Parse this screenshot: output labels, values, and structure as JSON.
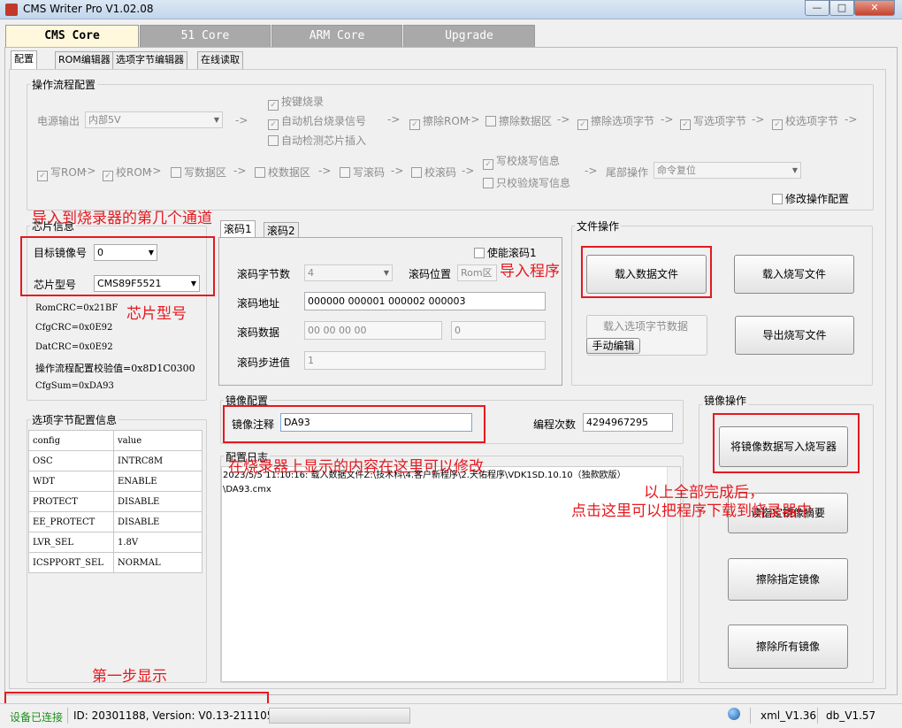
{
  "window": {
    "title": "CMS Writer Pro V1.02.08",
    "min": "—",
    "max": "□",
    "close": "✕"
  },
  "main_tabs": [
    "CMS Core",
    "51 Core",
    "ARM Core",
    "Upgrade"
  ],
  "sub_tabs": [
    "配置",
    "ROM编辑器",
    "选项字节编辑器",
    "在线读取"
  ],
  "flow": {
    "title": "操作流程配置",
    "power_label": "电源输出",
    "power_value": "内部5V",
    "steps1": [
      "按键烧录",
      "自动机台烧录信号",
      "自动检测芯片插入"
    ],
    "steps2": [
      "擦除ROM",
      "擦除数据区",
      "擦除选项字节",
      "写选项字节",
      "校选项字节"
    ],
    "steps3": [
      "写ROM",
      "校ROM",
      "写数据区",
      "校数据区",
      "写滚码",
      "校滚码"
    ],
    "steps4": [
      "写校烧写信息",
      "只校验烧写信息"
    ],
    "tail_label": "尾部操作",
    "tail_value": "命令复位",
    "modify": "修改操作配置",
    "arrow": "->"
  },
  "chip": {
    "title": "芯片信息",
    "mirror_label": "目标镜像号",
    "mirror_value": "0",
    "model_label": "芯片型号",
    "model_value": "CMS89F5521",
    "lines": [
      "RomCRC=0x21BF",
      "CfgCRC=0x0E92",
      "DatCRC=0x0E92",
      "操作流程配置校验值=0x8D1C0300",
      "CfgSum=0xDA93"
    ]
  },
  "option": {
    "title": "选项字节配置信息",
    "headers": [
      "config",
      "value"
    ],
    "rows": [
      [
        "OSC",
        "INTRC8M"
      ],
      [
        "WDT",
        "ENABLE"
      ],
      [
        "PROTECT",
        "DISABLE"
      ],
      [
        "EE_PROTECT",
        "DISABLE"
      ],
      [
        "LVR_SEL",
        "1.8V"
      ],
      [
        "ICSPPORT_SEL",
        "NORMAL"
      ]
    ]
  },
  "rolling": {
    "tabs": [
      "滚码1",
      "滚码2"
    ],
    "enable": "使能滚码1",
    "bytes_label": "滚码字节数",
    "bytes_value": "4",
    "pos_label": "滚码位置",
    "pos_value": "Rom区",
    "addr_label": "滚码地址",
    "addr_value": "000000 000001 000002 000003",
    "data_label": "滚码数据",
    "data_value": "00 00 00 00",
    "data_value2": "0",
    "step_label": "滚码步进值",
    "step_value": "1"
  },
  "file_ops": {
    "title": "文件操作",
    "load_data": "载入数据文件",
    "load_burn": "载入烧写文件",
    "load_option": "载入选项字节数据",
    "manual": "手动编辑",
    "export": "导出烧写文件"
  },
  "mirror_cfg": {
    "title": "镜像配置",
    "note_label": "镜像注释",
    "note_value": "DA93",
    "count_label": "编程次数",
    "count_value": "4294967295"
  },
  "log": {
    "title": "配置日志",
    "text": "2023/5/5 11:10:16: 载入数据文件Z:\\技术科\\4.客户新程序\\2.天佑程序\\VDK1SD.10.10（独款欧版）\\DA93.cmx"
  },
  "mirror_ops": {
    "title": "镜像操作",
    "write": "将镜像数据写入烧写器",
    "read": "读指定镜像摘要",
    "erase_one": "擦除指定镜像",
    "erase_all": "擦除所有镜像"
  },
  "annotations": {
    "channel": "导入到烧录器的第几个通道",
    "model": "芯片型号",
    "import": "导入程序",
    "modify": "在烧录器上显示的内容在这里可以修改",
    "done1": "以上全部完成后，",
    "done2": "点击这里可以把程序下载到烧录器中",
    "step1": "第一步显示"
  },
  "status": {
    "connected": "设备已连接",
    "id": "ID: 20301188, Version: V0.13-211105",
    "xml": "xml_V1.36",
    "db": "db_V1.57"
  },
  "colors": {
    "annotation_red": "#e5191f",
    "connected_green": "#1a8f1a"
  }
}
